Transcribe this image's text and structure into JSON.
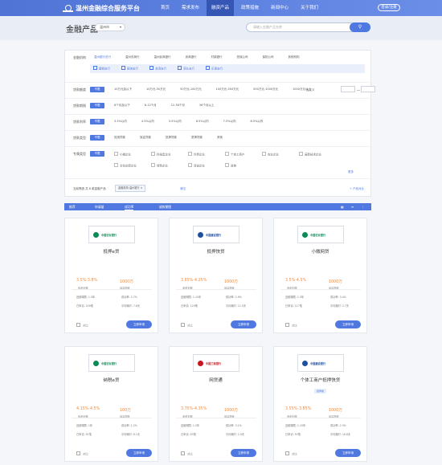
{
  "header": {
    "site_title": "温州金融综合服务平台",
    "nav": [
      "首页",
      "需求发布",
      "融资产品",
      "政策措施",
      "新闻中心",
      "关于我们"
    ],
    "active_nav": 2,
    "login": "登录/注册"
  },
  "band": {
    "page_title": "金融产品",
    "city": "温州市",
    "search_placeholder": "请输入金融产品名称"
  },
  "filters": {
    "institution": {
      "label": "金融机构",
      "btn": "不限",
      "options": [
        "温州银行总行",
        "温州农商行",
        "温州民商银行",
        "浙商银行",
        "村镇银行",
        "担保公司",
        "保险公司",
        "其他机构"
      ],
      "sub": [
        "鹿城支行",
        "瓯海支行",
        "龙湾支行",
        "洞头支行",
        "乐清支行"
      ]
    },
    "amount": {
      "label": "贷款额度",
      "btn": "不限",
      "options": [
        "10万元及以下",
        "10万元-50万元",
        "50万元-100万元",
        "100万元-500万元",
        "500万元-1000万元",
        "1000万元以上"
      ],
      "custom_label": "自定义",
      "dash": "—"
    },
    "term": {
      "label": "贷款期限",
      "btn": "不限",
      "options": [
        "6个月及以下",
        "6-12个月",
        "12-36个月",
        "36个月以上"
      ]
    },
    "rate": {
      "label": "贷款利率",
      "btn": "不限",
      "options": [
        "3.5%以内",
        "4.5%以内",
        "5.5%以内",
        "6.5%以内",
        "7.5%以内",
        "8.5%以内"
      ]
    },
    "type": {
      "label": "贷款类型",
      "btn": "不限",
      "options": [
        "信用贷款",
        "保证贷款",
        "抵押贷款",
        "质押贷款",
        "其他"
      ]
    },
    "feature": {
      "label": "专属类型",
      "btn": "不限",
      "options": [
        "小微企业",
        "科技型企业",
        "外贸企业",
        "个体工商户",
        "农业企业",
        "高新技术企业",
        "文化创意企业",
        "绿色企业",
        "双创企业",
        "其他"
      ],
      "more": "更多"
    },
    "footer": {
      "label": "当前筛选",
      "result": "共 8 款金融产品",
      "tag": "金融机构:温州银行 ×",
      "clear": "清空",
      "compare": "+ 产品对比"
    }
  },
  "sort": {
    "items": [
      "推荐",
      "申请量",
      "成功率",
      "放款期限"
    ],
    "selected": 2
  },
  "cards": [
    {
      "bank": "中国农业银行",
      "product": "抵押e贷",
      "rate": "3.5%-3.8%",
      "limit": "1000万",
      "rate_label": "参考利率",
      "limit_label": "最高额度",
      "term": "还款期限: 1-5年",
      "apply_rate": "成功率: 2.7%",
      "applied": "已申请: 209笔",
      "avg": "平均耗时: 7.8天",
      "compare": "对比",
      "apply": "立即申请",
      "color": "#0a8a55",
      "tag": ""
    },
    {
      "bank": "中国建设银行",
      "product": "抵押快贷",
      "rate": "3.85%-4.25%",
      "limit": "1000万",
      "rate_label": "参考利率",
      "limit_label": "最高额度",
      "term": "还款期限: 1-10年",
      "apply_rate": "成功率: 2.9%",
      "applied": "已申请: 129笔",
      "avg": "平均耗时: 11.5天",
      "compare": "对比",
      "apply": "立即申请",
      "color": "#1e4fa0",
      "tag": ""
    },
    {
      "bank": "中国农业银行",
      "product": "小微网贷",
      "rate": "3.5%-4.5%",
      "limit": "1000万",
      "rate_label": "参考利率",
      "limit_label": "最高额度",
      "term": "还款期限: 1-3年",
      "apply_rate": "成功率: 3.4%",
      "applied": "已申请: 117笔",
      "avg": "平均耗时: 2.7天",
      "compare": "对比",
      "apply": "立即申请",
      "color": "#0a8a55",
      "tag": ""
    },
    {
      "bank": "中国农业银行",
      "product": "纳税e贷",
      "rate": "4.15%-4.5%",
      "limit": "100万",
      "rate_label": "参考利率",
      "limit_label": "最高额度",
      "term": "还款期限: 1年",
      "apply_rate": "成功率: 1.2%",
      "applied": "已申请: 91笔",
      "avg": "平均耗时: 6.1天",
      "compare": "对比",
      "apply": "立即申请",
      "color": "#0a8a55",
      "tag": ""
    },
    {
      "bank": "中国工商银行",
      "product": "网贷通",
      "rate": "3.75%-4.35%",
      "limit": "1000万",
      "rate_label": "参考利率",
      "limit_label": "最高额度",
      "term": "还款期限: 1-2年",
      "apply_rate": "成功率: 3.1%",
      "applied": "已申请: 63笔",
      "avg": "平均耗时: 2.9天",
      "compare": "对比",
      "apply": "立即申请",
      "color": "#c7161e",
      "tag": ""
    },
    {
      "bank": "中国建设银行",
      "product": "个体工商户抵押快贷",
      "rate": "3.55%-3.85%",
      "limit": "1000万",
      "rate_label": "参考利率",
      "limit_label": "最高额度",
      "term": "还款期限: 1-10年",
      "apply_rate": "成功率: 2.3%",
      "applied": "已申请: 50笔",
      "avg": "平均耗时: 16.8天",
      "compare": "对比",
      "apply": "立即申请",
      "color": "#1e4fa0",
      "tag": "抵押类"
    }
  ]
}
